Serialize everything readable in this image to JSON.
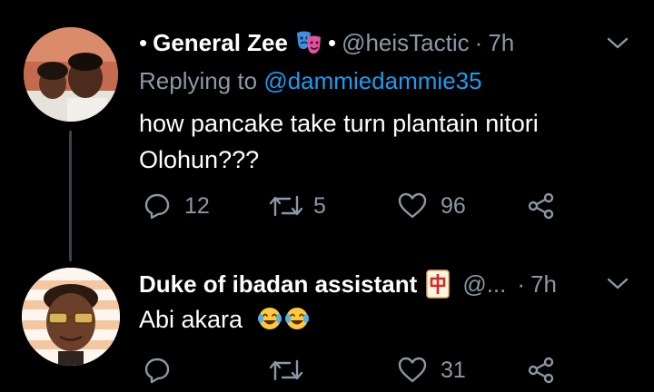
{
  "tweet1": {
    "bullet": "•",
    "name": "General Zee",
    "name_emoji": "performing-arts-masks-icon",
    "separator": "•",
    "handle": "@heisTactic",
    "time_separator": "·",
    "time": "7h",
    "replying_label": "Replying to",
    "replying_to": "@dammiedammie35",
    "text": "how pancake take turn plantain nitori Olohun???",
    "replies": "12",
    "retweets": "5",
    "likes": "96"
  },
  "tweet2": {
    "name": "Duke of ibadan assistant",
    "name_emoji": "mahjong-red-dragon-icon",
    "handle": "@...",
    "time_separator": "·",
    "time": "7h",
    "text": "Abi akara",
    "text_emojis": [
      "face-with-tears-of-joy-icon",
      "face-with-tears-of-joy-icon"
    ],
    "replies": "",
    "retweets": "",
    "likes": "31"
  },
  "colors": {
    "background": "#000000",
    "text": "#ffffff",
    "muted": "#8b98a5",
    "link": "#1d9bf0",
    "thread_line": "#3d4248"
  }
}
